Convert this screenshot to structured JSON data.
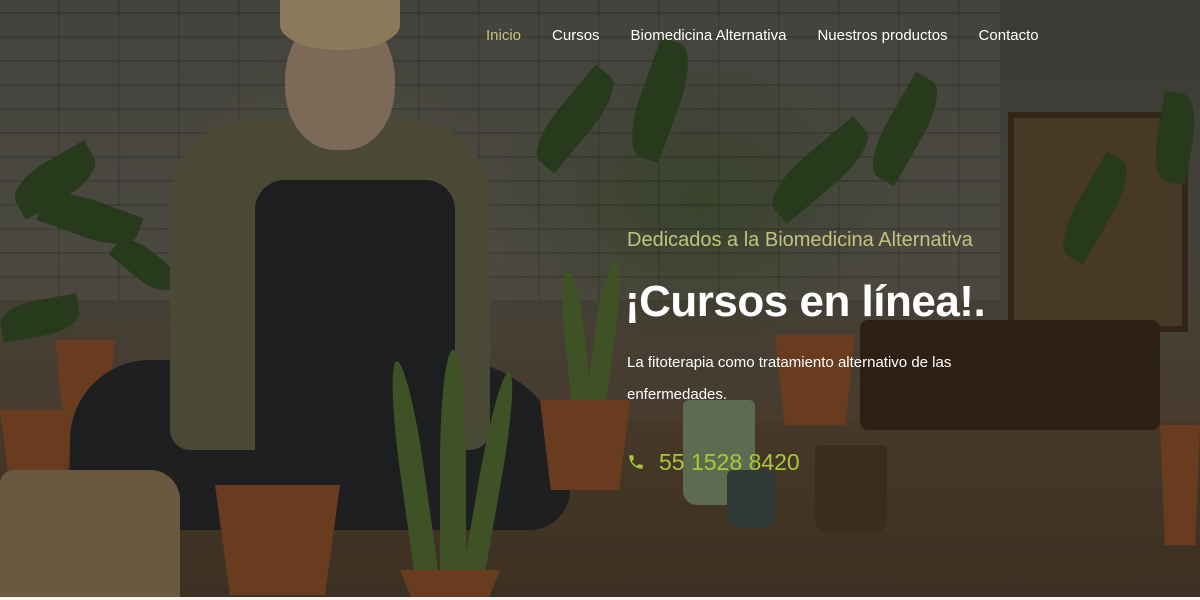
{
  "nav": {
    "items": [
      {
        "label": "Inicio",
        "active": true
      },
      {
        "label": "Cursos",
        "active": false
      },
      {
        "label": "Biomedicina Alternativa",
        "active": false
      },
      {
        "label": "Nuestros productos",
        "active": false
      },
      {
        "label": "Contacto",
        "active": false
      }
    ]
  },
  "hero": {
    "subtitle": "Dedicados a la Biomedicina Alternativa",
    "title": "¡Cursos en línea!.",
    "description": "La fitoterapia como tratamiento alternativo de las enfermedades.",
    "phone": "55 1528 8420",
    "phone_icon": "phone-icon"
  },
  "colors": {
    "nav_active": "#c7c27c",
    "subtitle": "#c3c27f",
    "phone": "#a8c83a",
    "text": "#ffffff"
  }
}
